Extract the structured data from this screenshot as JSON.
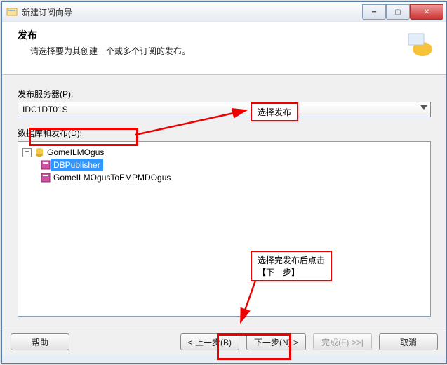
{
  "window": {
    "title": "新建订阅向导"
  },
  "header": {
    "title": "发布",
    "subtitle": "请选择要为其创建一个或多个订阅的发布。"
  },
  "publisherServer": {
    "label": "发布服务器(P):",
    "selected": "IDC1DT01S"
  },
  "dbAndPublications": {
    "label": "数据库和发布(D):",
    "root": "GomeILMOgus",
    "children": [
      {
        "name": "DBPublisher",
        "selected": true
      },
      {
        "name": "GomeILMOgusToEMPMDOgus",
        "selected": false
      }
    ]
  },
  "annotations": {
    "select_publication": "选择发布",
    "after_select": "选择完发布后点击\n【下一步】"
  },
  "buttons": {
    "help": "帮助",
    "back": "< 上一步(B)",
    "next": "下一步(N) >",
    "finish": "完成(F) >>|",
    "cancel": "取消"
  }
}
